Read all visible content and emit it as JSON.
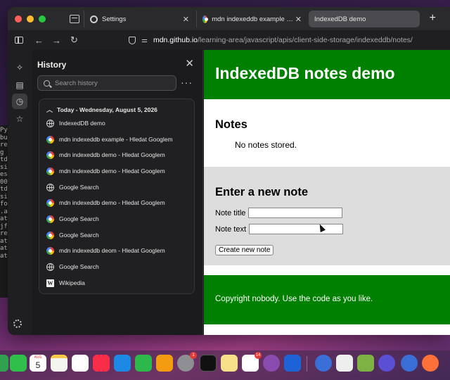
{
  "terminal": {
    "lines": [
      "",
      "",
      "Py",
      "",
      "bu",
      "re",
      "g r",
      "",
      "td",
      "sig",
      "es",
      "00",
      "td",
      "sig",
      "fo",
      ".a",
      "at",
      "jf",
      "re",
      "",
      "at",
      "at",
      "at",
      "",
      "at",
      "bu",
      "re"
    ]
  },
  "browser": {
    "tabs": [
      {
        "title": "Settings",
        "icon": "gear-icon",
        "active": false
      },
      {
        "title": "mdn indexeddb example - Hledat Googlem",
        "icon": "google-icon",
        "active": false
      },
      {
        "title": "IndexedDB demo",
        "icon": "",
        "active": true
      }
    ],
    "new_tab_label": "+",
    "address": {
      "host": "mdn.github.io",
      "path": "/learning-area/javascript/apis/client-side-storage/indexeddb/notes/"
    }
  },
  "history_panel": {
    "title": "History",
    "search_placeholder": "Search history",
    "more_label": "···",
    "day_header": "Today - Wednesday, August 5, 2026",
    "items": [
      {
        "title": "IndexedDB demo",
        "icon": "globe-icon"
      },
      {
        "title": "mdn indexeddb example - Hledat Googlem",
        "icon": "google-icon"
      },
      {
        "title": "mdn indexeddb demo - Hledat Googlem",
        "icon": "google-icon"
      },
      {
        "title": "mdn indexeddb demo - Hledat Googlem",
        "icon": "google-icon"
      },
      {
        "title": "Google Search",
        "icon": "globe-icon"
      },
      {
        "title": "mdn indexeddb demo - Hledat Googlem",
        "icon": "google-icon"
      },
      {
        "title": "Google Search",
        "icon": "google-icon"
      },
      {
        "title": "Google Search",
        "icon": "google-icon"
      },
      {
        "title": "mdn indexeddb deom - Hledat Googlem",
        "icon": "google-icon"
      },
      {
        "title": "Google Search",
        "icon": "globe-icon"
      },
      {
        "title": "Wikipedia",
        "icon": "wikipedia-icon"
      }
    ]
  },
  "page": {
    "heading": "IndexedDB notes demo",
    "notes_heading": "Notes",
    "notes_empty": "No notes stored.",
    "form_heading": "Enter a new note",
    "note_title_label": "Note title",
    "note_text_label": "Note text",
    "note_title_value": "",
    "note_text_value": "",
    "create_button": "Create new note",
    "footer": "Copyright nobody. Use the code as you like."
  },
  "dock": {
    "calendar_month": "AUG",
    "calendar_day": "5",
    "badges": {
      "settings": "1",
      "slack": "14"
    }
  }
}
